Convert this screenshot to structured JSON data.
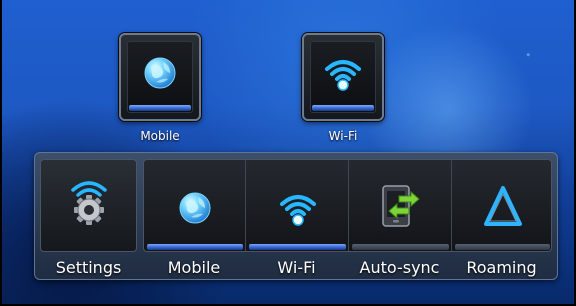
{
  "shortcuts": [
    {
      "label": "Mobile",
      "icon": "globe-icon"
    },
    {
      "label": "Wi-Fi",
      "icon": "wifi-icon"
    }
  ],
  "power_widget": {
    "settings": {
      "label": "Settings",
      "icon": "gear-wifi-icon"
    },
    "toggles": [
      {
        "label": "Mobile",
        "icon": "globe-icon",
        "state": "on"
      },
      {
        "label": "Wi-Fi",
        "icon": "wifi-icon",
        "state": "on"
      },
      {
        "label": "Auto-sync",
        "icon": "sync-phone-icon",
        "state": "off"
      },
      {
        "label": "Roaming",
        "icon": "roaming-triangle-icon",
        "state": "off"
      }
    ]
  },
  "colors": {
    "accent_on": "#3566d1",
    "wifi_cyan": "#27b6ff",
    "background": "#1e59c4"
  }
}
